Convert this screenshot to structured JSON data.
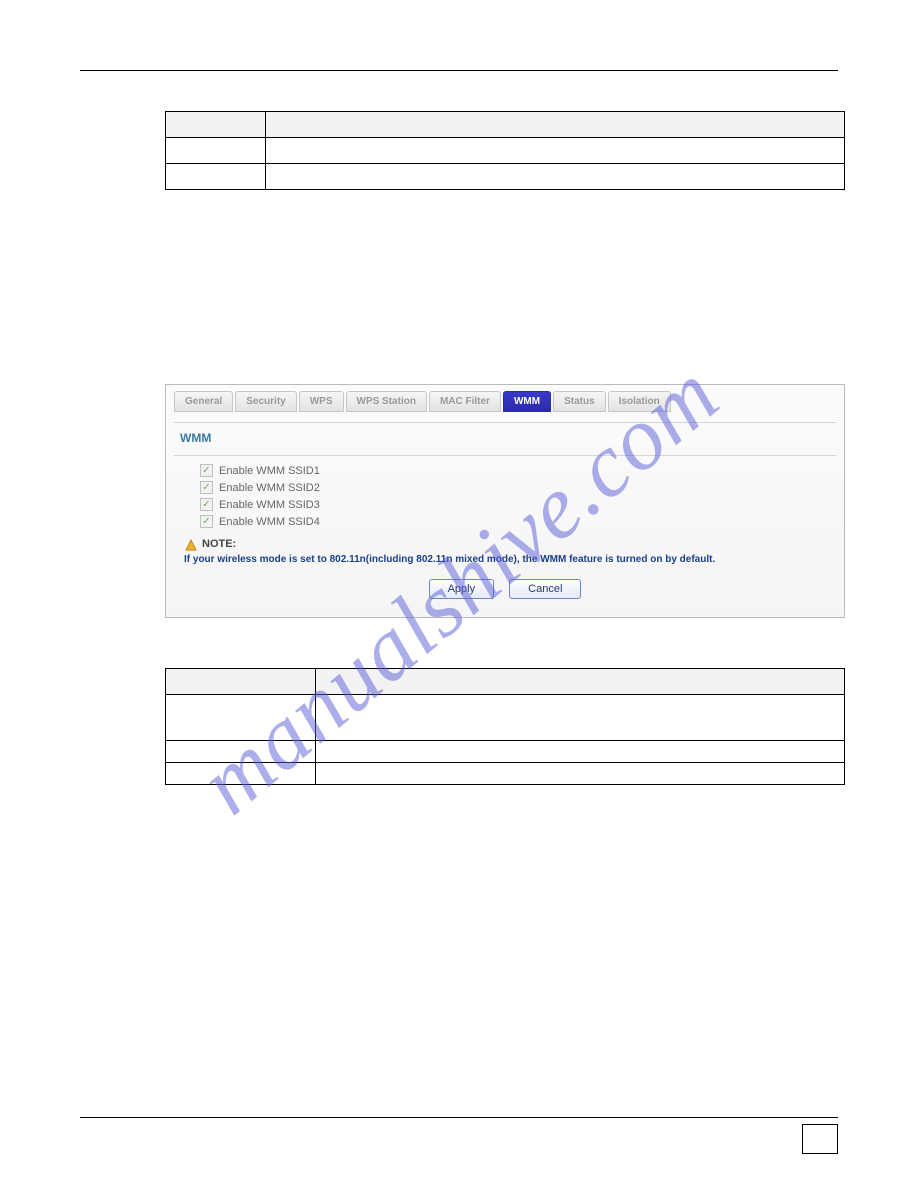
{
  "watermark": "manualshive.com",
  "table1": {
    "col1_header": "",
    "col2_header": "",
    "rows": [
      {
        "c1": "",
        "c2": ""
      },
      {
        "c1": "",
        "c2": ""
      }
    ]
  },
  "router": {
    "tabs": [
      {
        "label": "General",
        "active": false
      },
      {
        "label": "Security",
        "active": false
      },
      {
        "label": "WPS",
        "active": false
      },
      {
        "label": "WPS Station",
        "active": false
      },
      {
        "label": "MAC Filter",
        "active": false
      },
      {
        "label": "WMM",
        "active": true
      },
      {
        "label": "Status",
        "active": false
      },
      {
        "label": "Isolation",
        "active": false
      }
    ],
    "section_title": "WMM",
    "checkboxes": [
      {
        "label": "Enable WMM SSID1",
        "checked": true
      },
      {
        "label": "Enable WMM SSID2",
        "checked": true
      },
      {
        "label": "Enable WMM SSID3",
        "checked": true
      },
      {
        "label": "Enable WMM SSID4",
        "checked": true
      }
    ],
    "note_label": "NOTE:",
    "note_text": "If your wireless mode is set to 802.11n(including 802.11n mixed mode), the WMM feature is turned on by default.",
    "apply_label": "Apply",
    "cancel_label": "Cancel"
  },
  "table2": {
    "rows": [
      {
        "c1": "",
        "c2": ""
      },
      {
        "c1": "",
        "c2": ""
      },
      {
        "c1": "",
        "c2": ""
      }
    ]
  }
}
